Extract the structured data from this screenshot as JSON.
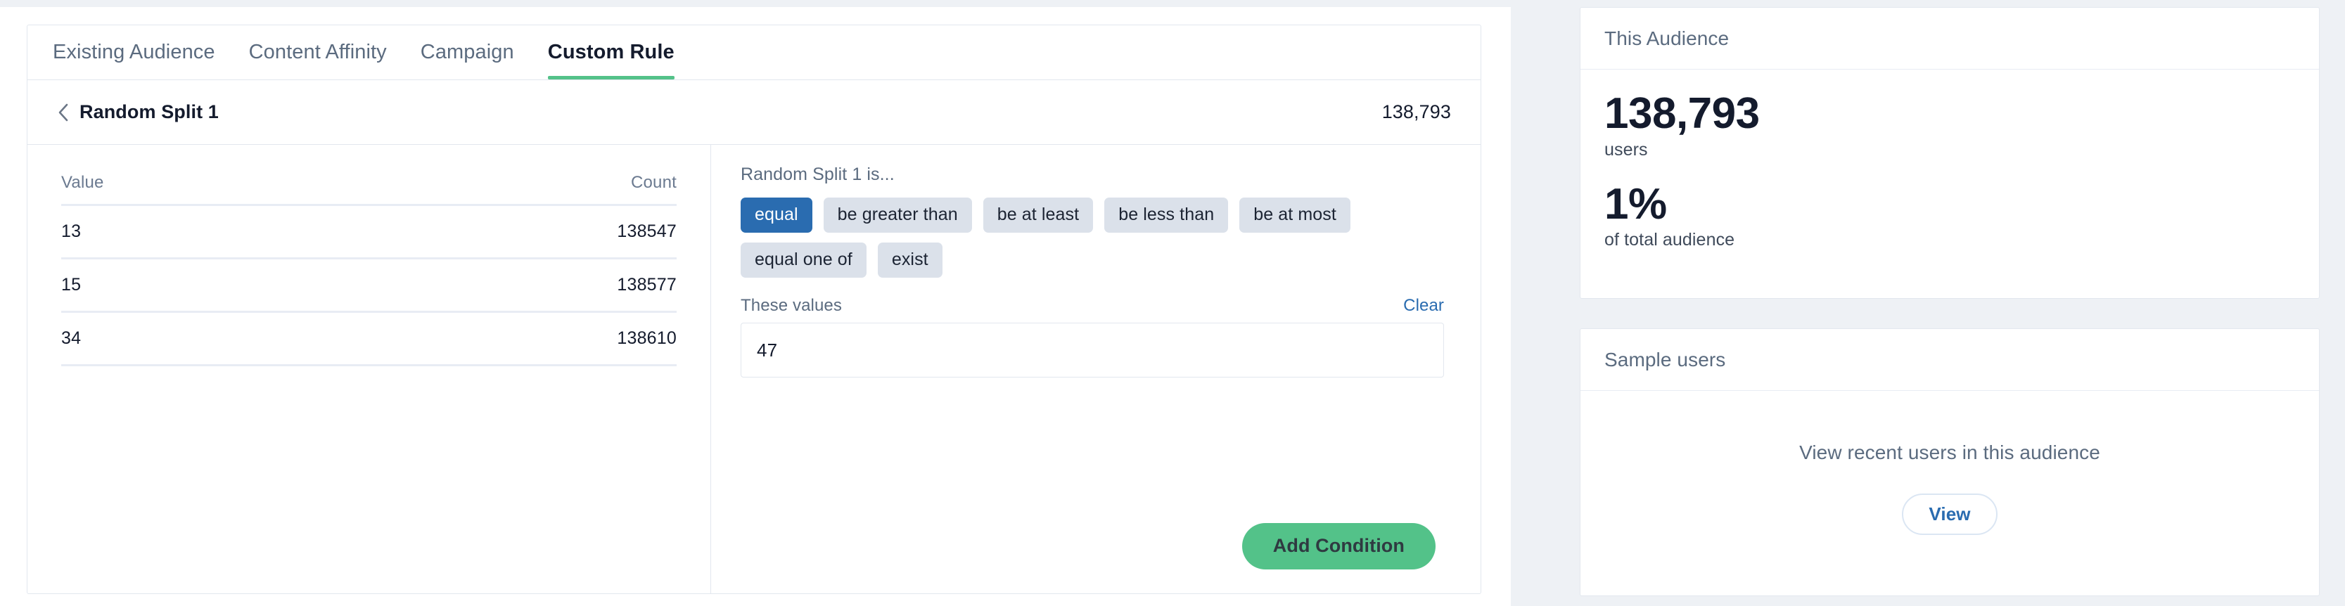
{
  "colors": {
    "accent_green": "#53c289",
    "accent_blue": "#2a6cb0",
    "pill_bg": "#dbe1ea",
    "page_bg": "#eef1f5",
    "text_dark": "#141b2d",
    "text_muted": "#5b6b7f",
    "border": "#e2e7ee"
  },
  "tabs": [
    {
      "label": "Existing Audience",
      "active": false
    },
    {
      "label": "Content Affinity",
      "active": false
    },
    {
      "label": "Campaign",
      "active": false
    },
    {
      "label": "Custom Rule",
      "active": true
    }
  ],
  "rule_header": {
    "back_icon": "chevron-left-icon",
    "title": "Random Split 1",
    "count": "138,793"
  },
  "value_table": {
    "columns": [
      "Value",
      "Count"
    ],
    "rows": [
      {
        "value": "13",
        "count": "138547"
      },
      {
        "value": "15",
        "count": "138577"
      },
      {
        "value": "34",
        "count": "138610"
      }
    ]
  },
  "condition": {
    "prompt": "Random Split 1 is...",
    "operators": [
      {
        "label": "equal",
        "selected": true
      },
      {
        "label": "be greater than",
        "selected": false
      },
      {
        "label": "be at least",
        "selected": false
      },
      {
        "label": "be less than",
        "selected": false
      },
      {
        "label": "be at most",
        "selected": false
      },
      {
        "label": "equal one of",
        "selected": false
      },
      {
        "label": "exist",
        "selected": false
      }
    ],
    "values_label": "These values",
    "clear_label": "Clear",
    "values_input": "47",
    "values_placeholder": "",
    "add_button": "Add Condition"
  },
  "sidebar": {
    "audience": {
      "title": "This Audience",
      "users_value": "138,793",
      "users_label": "users",
      "percent_value": "1%",
      "percent_label": "of total audience"
    },
    "sample": {
      "title": "Sample users",
      "empty_text": "View recent users in this audience",
      "view_button": "View"
    }
  }
}
